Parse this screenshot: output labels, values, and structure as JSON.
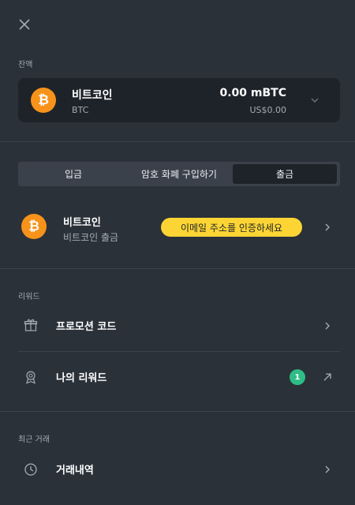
{
  "balance": {
    "section_label": "잔액",
    "coin_name": "비트코인",
    "coin_code": "BTC",
    "amount": "0.00 mBTC",
    "usd_value": "US$0.00"
  },
  "tabs": [
    {
      "label": "입금",
      "active": false
    },
    {
      "label": "암호 화폐 구입하기",
      "active": false
    },
    {
      "label": "출금",
      "active": true
    }
  ],
  "withdraw": {
    "coin_name": "비트코인",
    "subtitle": "비트코인 출금",
    "verify_label": "이메일 주소를 인증하세요"
  },
  "rewards": {
    "section_label": "리워드",
    "items": [
      {
        "label": "프로모션 코드",
        "icon": "gift-icon"
      },
      {
        "label": "나의 리워드",
        "icon": "award-icon",
        "badge": "1"
      }
    ]
  },
  "recent": {
    "section_label": "최근 거래",
    "items": [
      {
        "label": "거래내역",
        "icon": "clock-icon"
      }
    ]
  },
  "colors": {
    "background": "#2b3139",
    "card": "#1e2329",
    "bitcoin": "#f7931a",
    "accent_yellow": "#fcd535",
    "badge_green": "#2ebd85"
  }
}
